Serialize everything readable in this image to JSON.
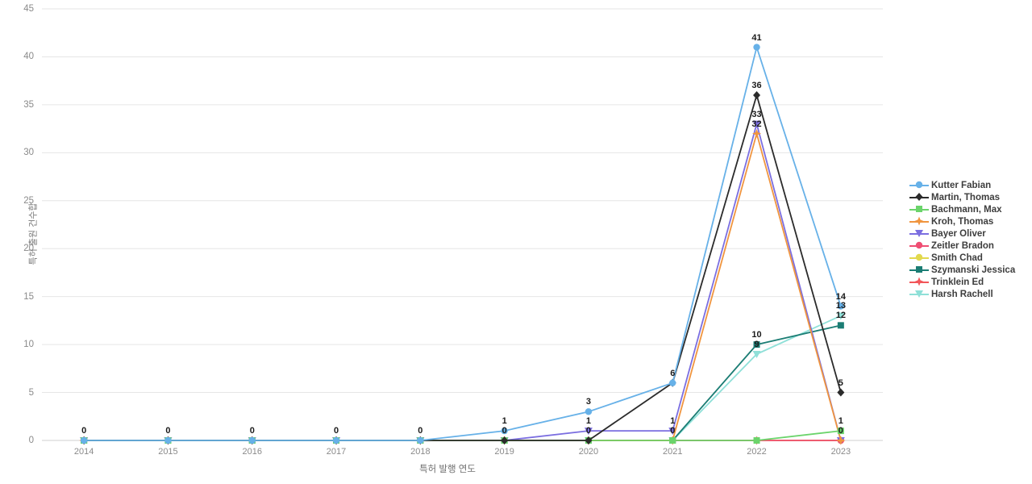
{
  "chart_data": {
    "type": "line",
    "title": "",
    "xlabel": "특허 발행 연도",
    "ylabel": "특허 출원 건수합",
    "categories": [
      "2014",
      "2015",
      "2016",
      "2017",
      "2018",
      "2019",
      "2020",
      "2021",
      "2022",
      "2023"
    ],
    "ylim": [
      0,
      45
    ],
    "yticks": [
      0,
      5,
      10,
      15,
      20,
      25,
      30,
      35,
      40,
      45
    ],
    "grid": true,
    "legend_position": "right",
    "show_data_labels": true,
    "series": [
      {
        "name": "Kutter Fabian",
        "color": "#67b1e8",
        "marker": "circle",
        "values": [
          0,
          0,
          0,
          0,
          0,
          1,
          3,
          6,
          41,
          14
        ]
      },
      {
        "name": "Martin, Thomas",
        "color": "#2b2b2b",
        "marker": "diamond",
        "values": [
          0,
          0,
          0,
          0,
          0,
          0,
          0,
          6,
          36,
          5
        ]
      },
      {
        "name": "Bachmann, Max",
        "color": "#6bd46b",
        "marker": "square",
        "values": [
          0,
          0,
          0,
          0,
          0,
          0,
          0,
          0,
          0,
          1
        ]
      },
      {
        "name": "Kroh, Thomas",
        "color": "#f0953f",
        "marker": "star",
        "values": [
          0,
          0,
          0,
          0,
          0,
          0,
          0,
          0,
          32,
          0
        ]
      },
      {
        "name": "Bayer Oliver",
        "color": "#7b6ee0",
        "marker": "triangle-down",
        "values": [
          0,
          0,
          0,
          0,
          0,
          0,
          1,
          1,
          33,
          0
        ]
      },
      {
        "name": "Zeitler Bradon",
        "color": "#ef4e73",
        "marker": "circle",
        "values": [
          0,
          0,
          0,
          0,
          0,
          0,
          0,
          0,
          0,
          0
        ]
      },
      {
        "name": "Smith Chad",
        "color": "#e2d94e",
        "marker": "circle",
        "values": [
          0,
          0,
          0,
          0,
          0,
          0,
          0,
          0,
          0,
          0
        ]
      },
      {
        "name": "Szymanski Jessica",
        "color": "#1b7d74",
        "marker": "square",
        "values": [
          0,
          0,
          0,
          0,
          0,
          0,
          0,
          0,
          10,
          12
        ]
      },
      {
        "name": "Trinklein Ed",
        "color": "#f2565a",
        "marker": "star",
        "values": [
          0,
          0,
          0,
          0,
          0,
          0,
          0,
          0,
          0,
          0
        ]
      },
      {
        "name": "Harsh Rachell",
        "color": "#8fe0d8",
        "marker": "triangle-down",
        "values": [
          0,
          0,
          0,
          0,
          0,
          0,
          0,
          0,
          9,
          13
        ]
      }
    ],
    "point_labels": [
      {
        "x": "2014",
        "value": "0"
      },
      {
        "x": "2015",
        "value": "0"
      },
      {
        "x": "2016",
        "value": "0"
      },
      {
        "x": "2017",
        "value": "0"
      },
      {
        "x": "2018",
        "value": "0"
      },
      {
        "x": "2019",
        "value": "1"
      },
      {
        "x": "2019",
        "value": "0"
      },
      {
        "x": "2020",
        "value": "3"
      },
      {
        "x": "2020",
        "value": "1"
      },
      {
        "x": "2020",
        "value": "0"
      },
      {
        "x": "2021",
        "value": "6"
      },
      {
        "x": "2021",
        "value": "1"
      },
      {
        "x": "2021",
        "value": "0"
      },
      {
        "x": "2022",
        "value": "41"
      },
      {
        "x": "2022",
        "value": "36"
      },
      {
        "x": "2022",
        "value": "33"
      },
      {
        "x": "2022",
        "value": "32"
      },
      {
        "x": "2022",
        "value": "10"
      },
      {
        "x": "2022",
        "value": "9"
      },
      {
        "x": "2023",
        "value": "14"
      },
      {
        "x": "2023",
        "value": "13"
      },
      {
        "x": "2023",
        "value": "12"
      },
      {
        "x": "2023",
        "value": "5"
      },
      {
        "x": "2023",
        "value": "1"
      },
      {
        "x": "2023",
        "value": "0"
      }
    ]
  },
  "legend": {
    "items": [
      {
        "label": "Kutter Fabian"
      },
      {
        "label": "Martin, Thomas"
      },
      {
        "label": "Bachmann, Max"
      },
      {
        "label": "Kroh, Thomas"
      },
      {
        "label": "Bayer Oliver"
      },
      {
        "label": "Zeitler Bradon"
      },
      {
        "label": "Smith Chad"
      },
      {
        "label": "Szymanski Jessica"
      },
      {
        "label": "Trinklein Ed"
      },
      {
        "label": "Harsh Rachell"
      }
    ]
  }
}
